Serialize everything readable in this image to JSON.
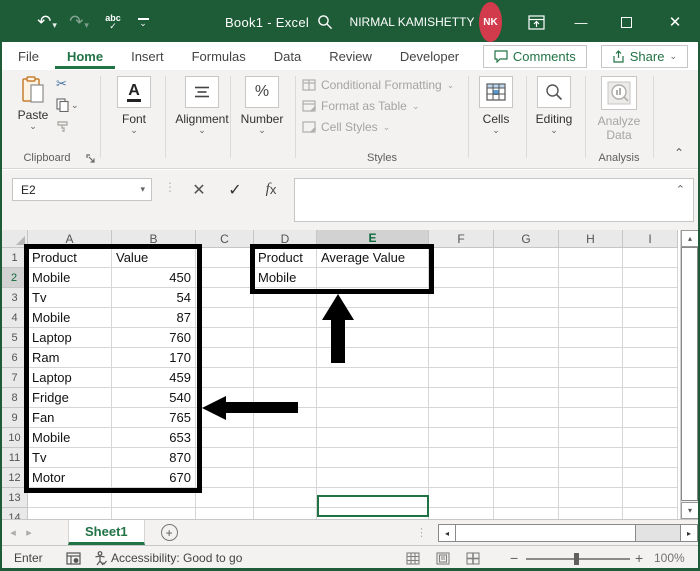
{
  "colors": {
    "accent": "#217346",
    "titlebar": "#1E5C38",
    "avatar": "#D13B4C"
  },
  "title_bar": {
    "title": "Book1 - Excel",
    "user_name": "NIRMAL KAMISHETTY",
    "avatar_initials": "NK"
  },
  "icons": {
    "undo": "↶",
    "redo": "↷",
    "spell_abc": "abc",
    "check": "✓",
    "cancel": "✕",
    "dropdown": "⌄",
    "dropdown_small": "▾",
    "minimize": "—",
    "scissors": "✂",
    "formula_collapse": "⌃",
    "ribbon_collapse": "⌃",
    "percent": "%",
    "font_a": "A",
    "nav_left": "◂",
    "nav_right": "▸",
    "scroll_up": "▴",
    "scroll_down": "▾",
    "plus": "+",
    "minus": "−",
    "dots_v": "⋮",
    "add": "+"
  },
  "ribbon_tabs": {
    "items": [
      {
        "label": "File"
      },
      {
        "label": "Home"
      },
      {
        "label": "Insert"
      },
      {
        "label": "Formulas"
      },
      {
        "label": "Data"
      },
      {
        "label": "Review"
      },
      {
        "label": "Developer"
      }
    ],
    "active": "Home",
    "comments_label": "Comments",
    "share_label": "Share"
  },
  "ribbon": {
    "paste_label": "Paste",
    "clipboard_group": "Clipboard",
    "font_group": "Font",
    "alignment_group": "Alignment",
    "number_group": "Number",
    "styles_buttons": [
      {
        "label": "Conditional Formatting"
      },
      {
        "label": "Format as Table"
      },
      {
        "label": "Cell Styles"
      }
    ],
    "styles_group": "Styles",
    "cells_group": "Cells",
    "editing_group": "Editing",
    "analyze_line1": "Analyze",
    "analyze_line2": "Data",
    "analysis_group": "Analysis"
  },
  "formula_bar": {
    "name_box": "E2",
    "fx_label": "fx"
  },
  "sheet": {
    "columns": [
      "A",
      "B",
      "C",
      "D",
      "E",
      "F",
      "G",
      "H",
      "I"
    ],
    "visible_rows": 14,
    "selected_column": "E",
    "selected_row": 2,
    "cells": {
      "A1": "Product",
      "B1": "Value",
      "A2": "Mobile",
      "B2": "450",
      "A3": "Tv",
      "B3": "54",
      "A4": "Mobile",
      "B4": "87",
      "A5": "Laptop",
      "B5": "760",
      "A6": "Ram",
      "B6": "170",
      "A7": "Laptop",
      "B7": "459",
      "A8": "Fridge",
      "B8": "540",
      "A9": "Fan",
      "B9": "765",
      "A10": "Mobile",
      "B10": "653",
      "A11": "Tv",
      "B11": "870",
      "A12": "Motor",
      "B12": "670",
      "D1": "Product",
      "E1": "Average Value",
      "D2": "Mobile",
      "E2": ""
    }
  },
  "sheet_tabs": {
    "tabs": [
      {
        "label": "Sheet1"
      }
    ],
    "active": "Sheet1"
  },
  "status_bar": {
    "mode": "Enter",
    "accessibility": "Accessibility: Good to go",
    "zoom_level": "100%"
  }
}
